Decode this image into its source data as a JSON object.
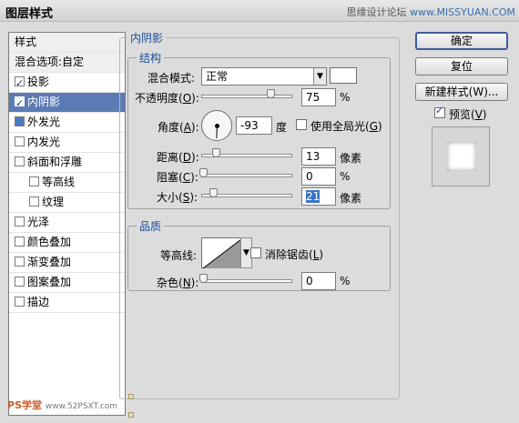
{
  "title": "图层样式",
  "watermark": {
    "prefix": "思缘设计论坛",
    "site": "www.MISSYUAN.COM"
  },
  "list": {
    "header": "样式",
    "blend": "混合选项:自定",
    "items": [
      {
        "label": "投影",
        "checked": true
      },
      {
        "label": "内阴影",
        "checked": true,
        "selected": true
      },
      {
        "label": "外发光",
        "checked": false
      },
      {
        "label": "内发光",
        "checked": false
      },
      {
        "label": "斜面和浮雕",
        "checked": false
      },
      {
        "label": "等高线",
        "checked": false,
        "sub": true
      },
      {
        "label": "纹理",
        "checked": false,
        "sub": true
      },
      {
        "label": "光泽",
        "checked": false
      },
      {
        "label": "颜色叠加",
        "checked": false
      },
      {
        "label": "渐变叠加",
        "checked": false
      },
      {
        "label": "图案叠加",
        "checked": false
      },
      {
        "label": "描边",
        "checked": false
      }
    ]
  },
  "panel": {
    "title": "内阴影",
    "structure": {
      "title": "结构",
      "blend_mode_label": "混合模式:",
      "blend_mode_value": "正常",
      "opacity_label": "不透明度(",
      "opacity_key": "O",
      "opacity_value": "75",
      "opacity_unit": "%",
      "angle_label": "角度(",
      "angle_key": "A",
      "angle_value": "-93",
      "angle_unit": "度",
      "global_light_label": "使用全局光(",
      "global_light_key": "G",
      "distance_label": "距离(",
      "distance_key": "D",
      "distance_value": "13",
      "distance_unit": "像素",
      "choke_label": "阻塞(",
      "choke_key": "C",
      "choke_value": "0",
      "choke_unit": "%",
      "size_label": "大小(",
      "size_key": "S",
      "size_value": "21",
      "size_unit": "像素"
    },
    "quality": {
      "title": "品质",
      "contour_label": "等高线:",
      "antialias_label": "消除锯齿(",
      "antialias_key": "L",
      "noise_label": "杂色(",
      "noise_key": "N",
      "noise_value": "0",
      "noise_unit": "%"
    }
  },
  "buttons": {
    "ok": "确定",
    "reset": "复位",
    "new_style": "新建样式(W)...",
    "preview_label": "预览(",
    "preview_key": "V"
  },
  "logo": {
    "main": "PS学堂",
    "site": "www.52PSXT.com"
  },
  "colors": {
    "selection": "#5c7bb5",
    "heading": "#1c4e9c"
  }
}
